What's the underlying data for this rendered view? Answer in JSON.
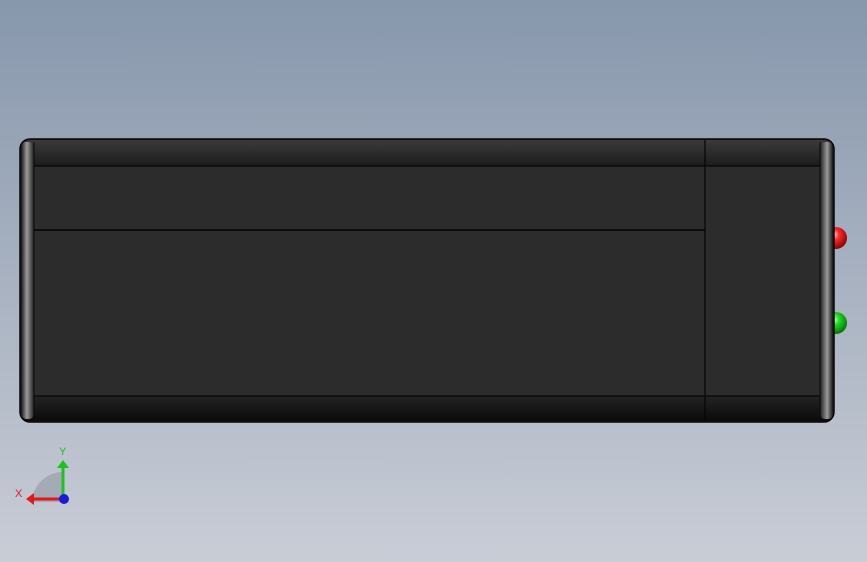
{
  "viewport": {
    "background_top": "#8797ac",
    "background_bottom": "#c9cdd6"
  },
  "model": {
    "body_color": "#2c2c2c",
    "edge_color": "#050505",
    "led_red": "#e01010",
    "led_green": "#10c010"
  },
  "triad": {
    "x_label": "X",
    "y_label": "Y",
    "x_color": "#e01a1a",
    "y_color": "#1ec21e",
    "z_color": "#1a1ad8"
  }
}
